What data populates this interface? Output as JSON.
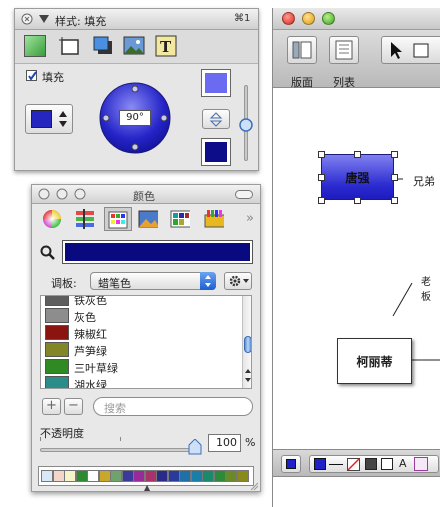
{
  "main_window": {
    "toolbar": {
      "layout_label": "版面",
      "list_label": "列表"
    },
    "canvas": {
      "node_tang": "唐强",
      "node_ke": "柯丽蒂",
      "relation_brother": "兄弟",
      "relation_partial": "老板"
    },
    "bottom_bar": {
      "text_tool": "A"
    }
  },
  "fill_inspector": {
    "title": "样式: 填充",
    "shortcut": "⌘1",
    "fill_checkbox_label": "填充",
    "fill_checked": true,
    "angle_value": "90°",
    "colors": {
      "fill": "#2020c8",
      "swatch_top": "#6b6bf2",
      "swatch_bottom": "#0d0d8a"
    }
  },
  "colors_window": {
    "title": "颜色",
    "palette_label": "调板:",
    "palette_value": "蜡笔色",
    "current_color": "#0a0a80",
    "list": [
      {
        "name": "铁灰色",
        "color": "#5e5e5e"
      },
      {
        "name": "灰色",
        "color": "#8d8d8d"
      },
      {
        "name": "辣椒红",
        "color": "#8b1410"
      },
      {
        "name": "芦笋绿",
        "color": "#838626"
      },
      {
        "name": "三叶草绿",
        "color": "#2f8a23"
      },
      {
        "name": "湖水绿",
        "color": "#2a8d8a"
      }
    ],
    "search_placeholder": "搜索",
    "opacity_label": "不透明度",
    "opacity_value": "100",
    "opacity_unit": "%",
    "opacity_level": 1.0,
    "add_label": "+",
    "remove_label": "−",
    "swatches": [
      "#d9e8f7",
      "#f2d6c9",
      "#f5f5c9",
      "#2d8a2d",
      "#ffffff",
      "#c8a72a",
      "#6ea36e",
      "#3a3a9a",
      "#9a2a9a",
      "#a8326b",
      "#2a2a8a",
      "#2a3a9a",
      "#1f6fa8",
      "#1a7fa8",
      "#1a8a6a",
      "#2d8a3a",
      "#6a8a2a",
      "#8a8a1a"
    ]
  }
}
